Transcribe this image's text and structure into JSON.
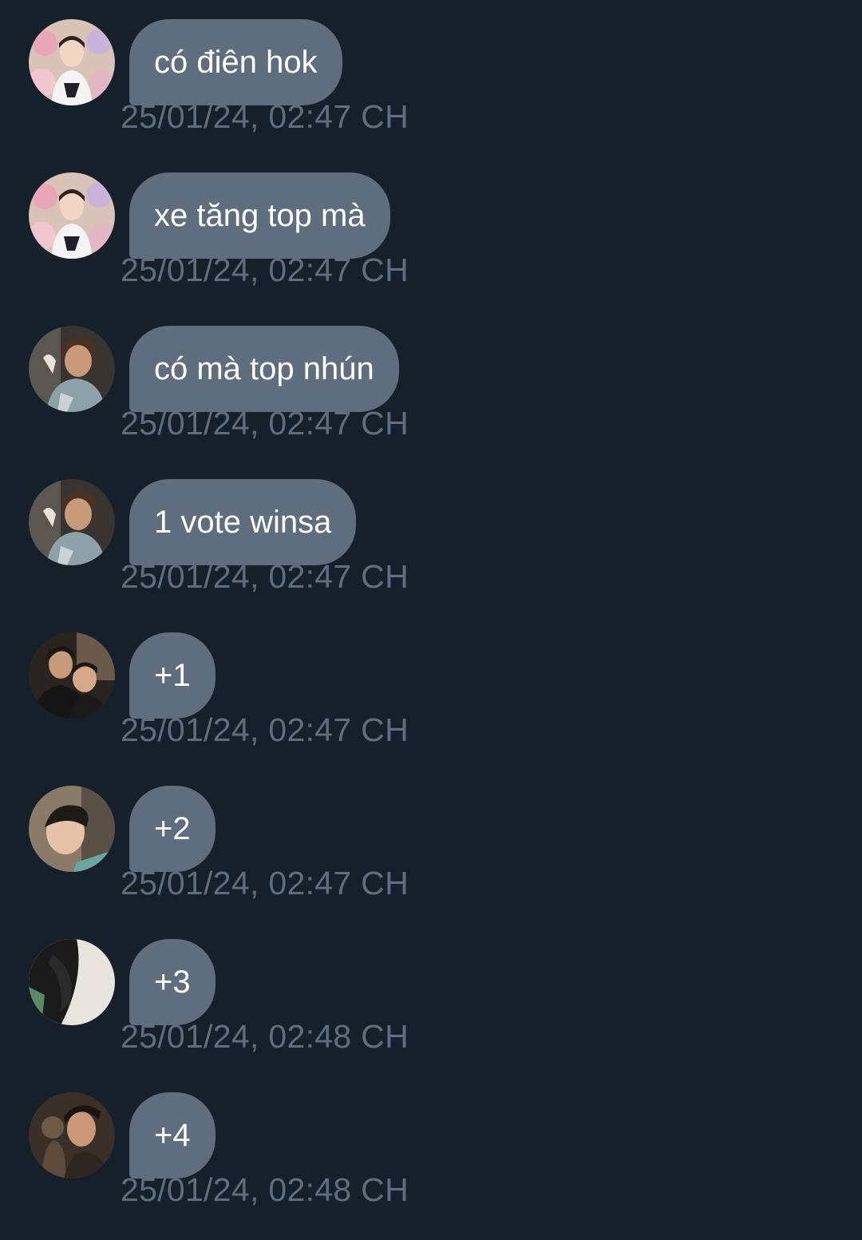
{
  "colors": {
    "background": "#16202b",
    "bubble": "#5f6e7f",
    "bubble_text": "#ffffff",
    "timestamp": "#5f6e7f"
  },
  "messages": [
    {
      "text": "có điên hok",
      "time": "25/01/24, 02:47 CH",
      "avatar": "user-a"
    },
    {
      "text": "xe tăng top mà",
      "time": "25/01/24, 02:47 CH",
      "avatar": "user-a"
    },
    {
      "text": "có mà top nhún",
      "time": "25/01/24, 02:47 CH",
      "avatar": "user-b"
    },
    {
      "text": "1 vote winsa",
      "time": "25/01/24, 02:47 CH",
      "avatar": "user-b"
    },
    {
      "text": "+1",
      "time": "25/01/24, 02:47 CH",
      "avatar": "user-c"
    },
    {
      "text": "+2",
      "time": "25/01/24, 02:47 CH",
      "avatar": "user-d"
    },
    {
      "text": "+3",
      "time": "25/01/24, 02:48 CH",
      "avatar": "user-e"
    },
    {
      "text": "+4",
      "time": "25/01/24, 02:48 CH",
      "avatar": "user-f"
    }
  ]
}
